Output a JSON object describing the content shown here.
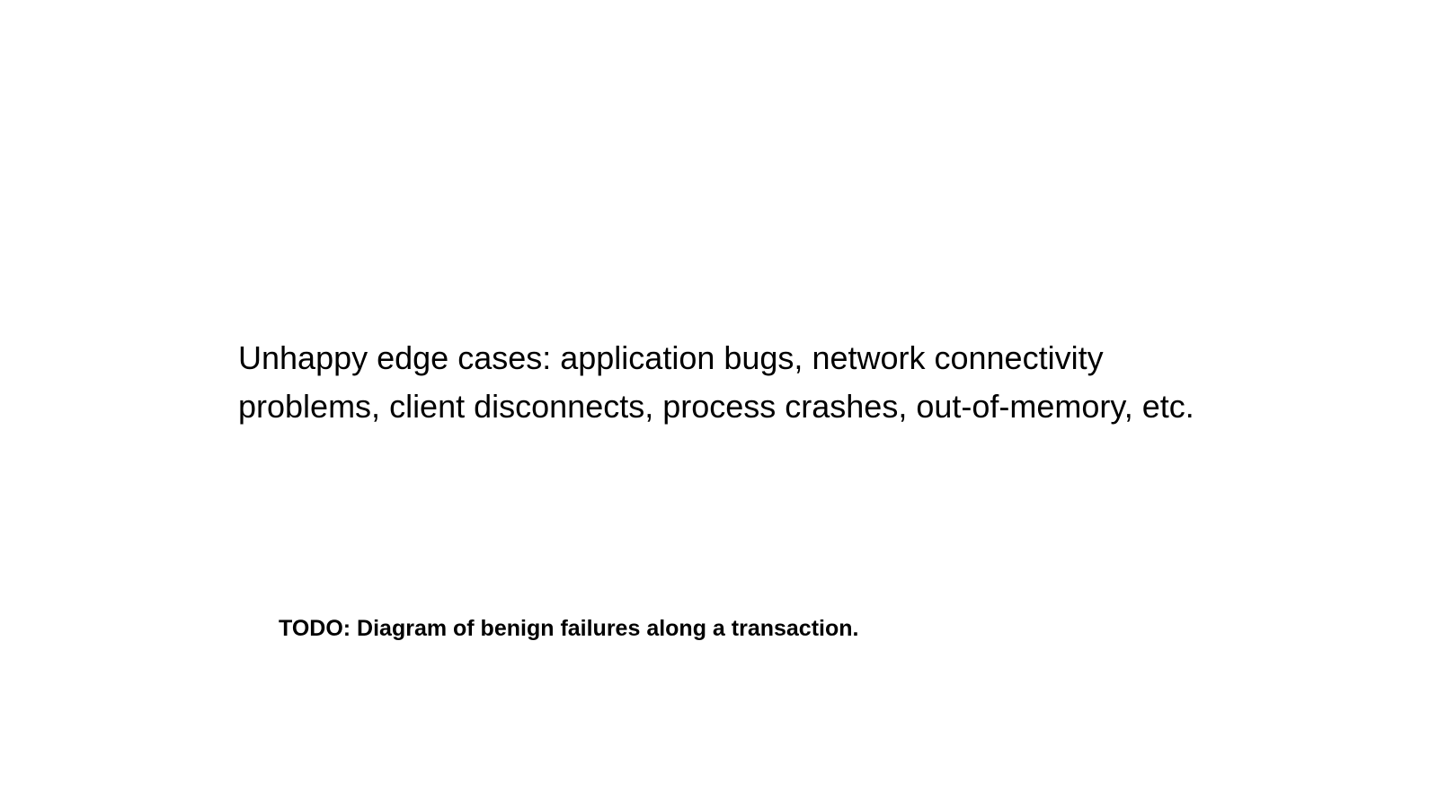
{
  "slide": {
    "body_text": "Unhappy edge cases: application bugs, network connectivity problems, client disconnects, process crashes, out-of-memory, etc.",
    "note": "TODO: Diagram of benign failures along a transaction."
  }
}
